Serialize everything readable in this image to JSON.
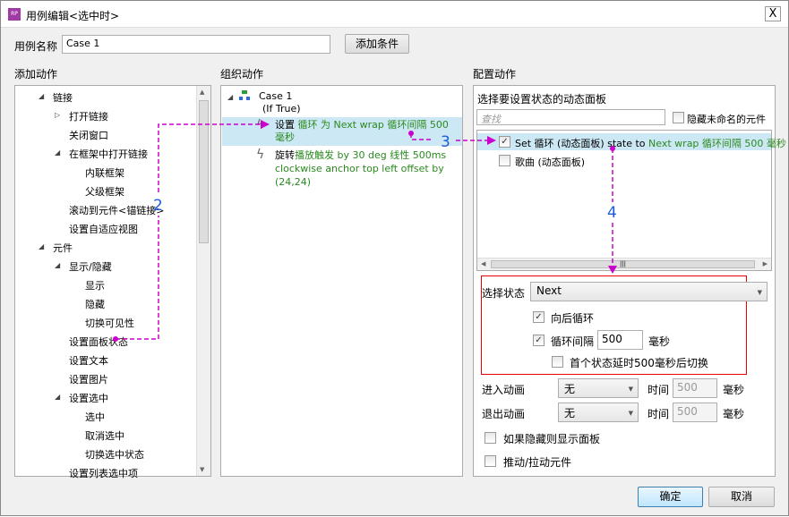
{
  "title": "用例编辑<选中时>",
  "close_label": "X",
  "case_name_label": "用例名称",
  "case_name_value": "Case 1",
  "add_condition": "添加条件",
  "sections": {
    "add": "添加动作",
    "organize": "组织动作",
    "configure": "配置动作"
  },
  "tree": [
    {
      "label": "链接",
      "level": 0,
      "expand": "open"
    },
    {
      "label": "打开链接",
      "level": 1,
      "expand": "closed"
    },
    {
      "label": "关闭窗口",
      "level": 1
    },
    {
      "label": "在框架中打开链接",
      "level": 1,
      "expand": "open"
    },
    {
      "label": "内联框架",
      "level": 2
    },
    {
      "label": "父级框架",
      "level": 2
    },
    {
      "label": "滚动到元件<锚链接>",
      "level": 1
    },
    {
      "label": "设置自适应视图",
      "level": 1
    },
    {
      "label": "元件",
      "level": 0,
      "expand": "open"
    },
    {
      "label": "显示/隐藏",
      "level": 1,
      "expand": "open"
    },
    {
      "label": "显示",
      "level": 2
    },
    {
      "label": "隐藏",
      "level": 2
    },
    {
      "label": "切换可见性",
      "level": 2
    },
    {
      "label": "设置面板状态",
      "level": 1
    },
    {
      "label": "设置文本",
      "level": 1
    },
    {
      "label": "设置图片",
      "level": 1
    },
    {
      "label": "设置选中",
      "level": 1,
      "expand": "open"
    },
    {
      "label": "选中",
      "level": 2
    },
    {
      "label": "取消选中",
      "level": 2
    },
    {
      "label": "切换选中状态",
      "level": 2
    },
    {
      "label": "设置列表选中项",
      "level": 1
    }
  ],
  "organize": {
    "case": "Case 1",
    "condition": "(If True)",
    "action1": {
      "prefix": "设置 ",
      "detail": "循环 为 Next wrap 循环间隔 500 毫秒"
    },
    "action2": {
      "prefix": "旋转",
      "detail": "播放触发 by 30 deg 线性 500ms clockwise anchor top left offset by (24,24)"
    }
  },
  "configure": {
    "heading": "选择要设置状态的动态面板",
    "search_placeholder": "查找",
    "hide_unnamed": "隐藏未命名的元件",
    "panels": [
      {
        "label": "Set 循环 (动态面板) state to ",
        "detail": "Next wrap 循环间隔 500 毫秒",
        "checked": true
      },
      {
        "label": "歌曲 (动态面板)",
        "detail": "",
        "checked": false
      }
    ],
    "select_state_label": "选择状态",
    "select_state_value": "Next",
    "wrap_label": "向后循环",
    "wrap_checked": true,
    "interval_label": "循环间隔",
    "interval_value": "500",
    "ms": "毫秒",
    "interval_checked": true,
    "first_delay_label": "首个状态延时500毫秒后切换",
    "first_delay_checked": false,
    "enter_anim_label": "进入动画",
    "enter_anim_value": "无",
    "exit_anim_label": "退出动画",
    "exit_anim_value": "无",
    "time_label": "时间",
    "enter_time": "500",
    "exit_time": "500",
    "show_if_hidden": "如果隐藏则显示面板",
    "push_widgets": "推动/拉动元件"
  },
  "ok": "确定",
  "cancel": "取消",
  "annotations": {
    "a2": "2",
    "a3": "3",
    "a4": "4",
    "color": "#cc00cc",
    "label_color": "#1e5bd8"
  }
}
